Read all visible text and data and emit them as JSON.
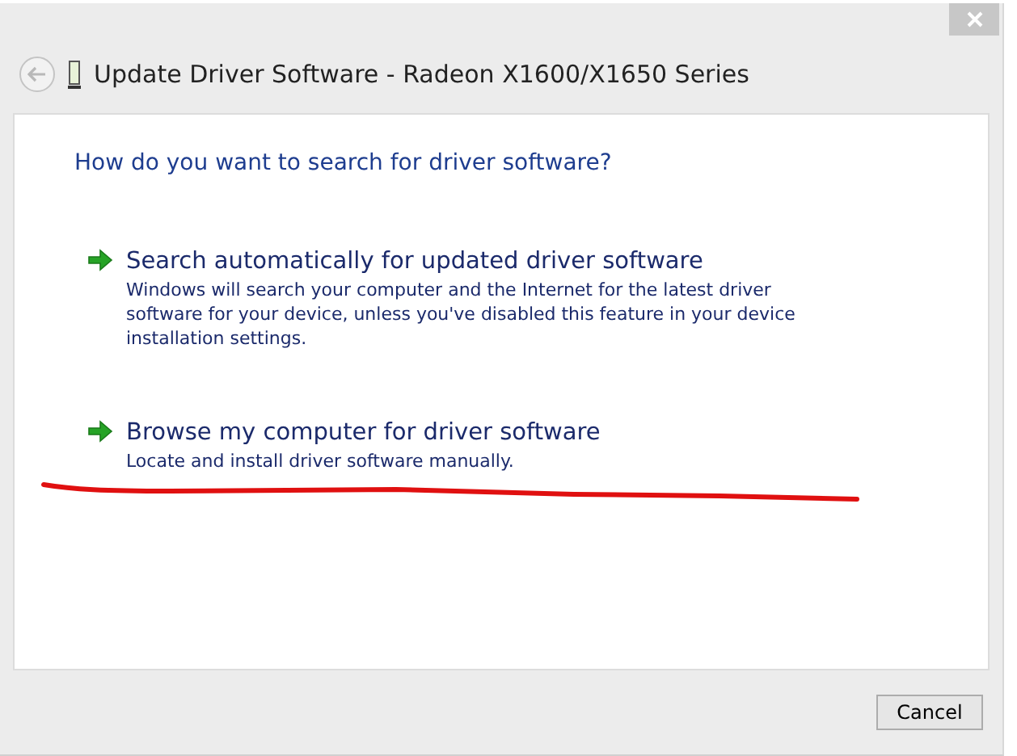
{
  "window": {
    "title": "Update Driver Software - Radeon X1600/X1650 Series"
  },
  "heading": "How do you want to search for driver software?",
  "options": [
    {
      "title": "Search automatically for updated driver software",
      "description": "Windows will search your computer and the Internet for the latest driver software for your device, unless you've disabled this feature in your device installation settings."
    },
    {
      "title": "Browse my computer for driver software",
      "description": "Locate and install driver software manually."
    }
  ],
  "buttons": [
    "Cancel"
  ]
}
